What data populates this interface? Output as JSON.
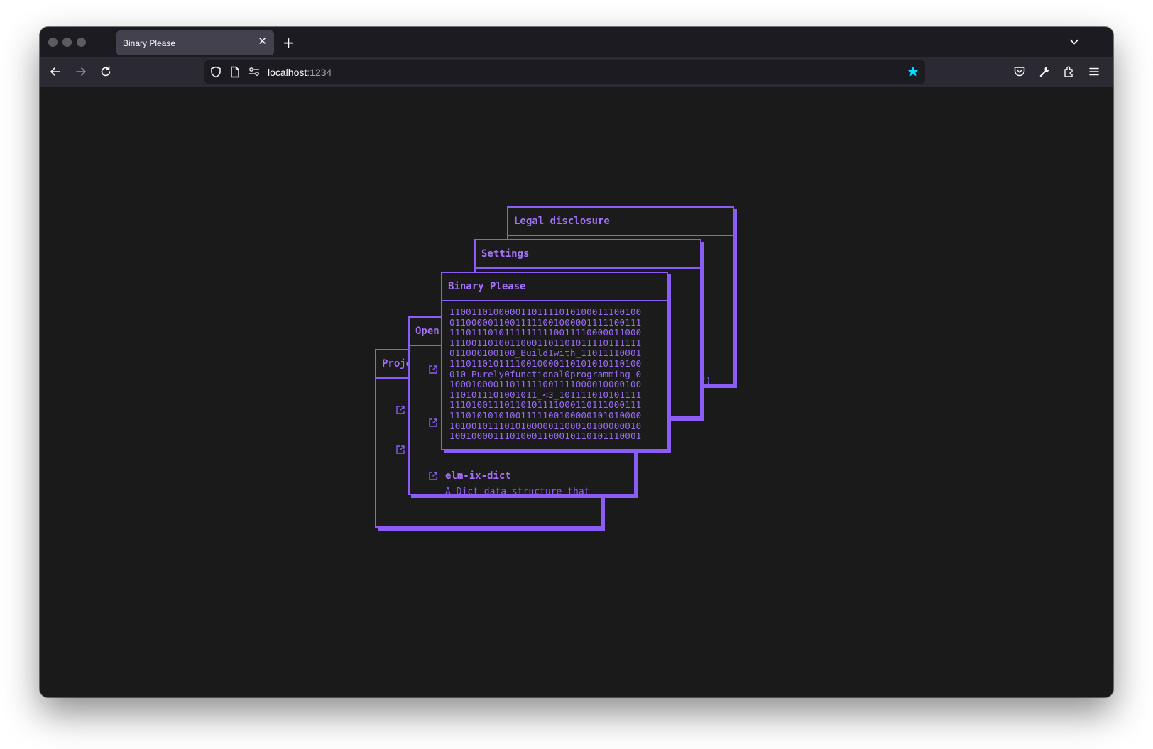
{
  "browser": {
    "tab_title": "Binary Please",
    "url_host": "localhost",
    "url_port": ":1234"
  },
  "panels": {
    "legal": {
      "title": "Legal disclosure",
      "fragment": "or)"
    },
    "settings": {
      "title": "Settings"
    },
    "binary": {
      "title": "Binary Please",
      "lines": [
        "11001101000001101111010100011100100",
        "01100000110011111001000001111100111",
        "11101110101111111110011110000011000",
        "11100110100110001101101011110111111",
        "011000100100_Build1with_11011110001",
        "11101101011110010000110101010110100",
        "010_Purely0functional0programming_0",
        "10001000011011111001111000010000100",
        "1101011101001011_<3_101111010101111",
        "11101001110110101111000110111000111",
        "11101010101001111100100000101010000",
        "10100101110101000001100010100000010",
        "10010000111010001100010110101110001"
      ]
    },
    "open": {
      "title": "Open source",
      "project_name": "elm-ix-dict",
      "project_desc": "A Dict data structure that"
    },
    "projects": {
      "title": "Projects"
    }
  },
  "colors": {
    "accent": "#8b5cf6",
    "background": "#1a1a1b"
  }
}
